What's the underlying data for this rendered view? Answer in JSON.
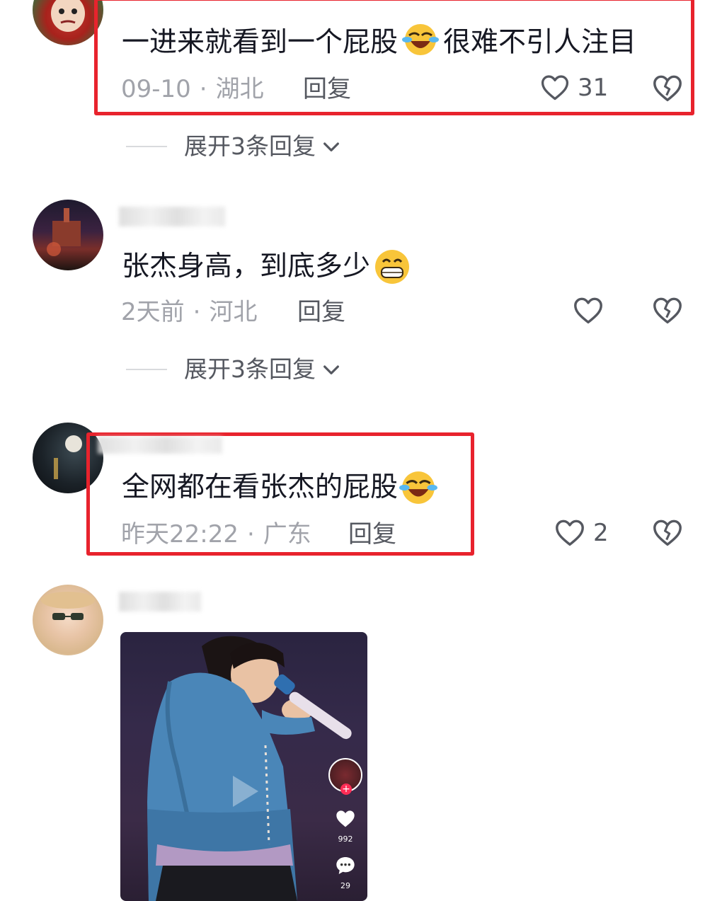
{
  "comments": [
    {
      "text": "一进来就看到一个屁股",
      "text2": "很难不引人注目",
      "date": "09-10",
      "location": "湖北",
      "reply_label": "回复",
      "likes": "31",
      "expand_label": "展开3条回复"
    },
    {
      "text": "张杰身高，到底多少",
      "date": "2天前",
      "location": "河北",
      "reply_label": "回复",
      "likes": "",
      "expand_label": "展开3条回复"
    },
    {
      "text": "全网都在看张杰的屁股",
      "date": "昨天22:22",
      "location": "广东",
      "reply_label": "回复",
      "likes": "2"
    },
    {
      "video": {
        "like_count": "992",
        "comment_count": "29"
      }
    }
  ],
  "colors": {
    "highlight": "#e8232d",
    "meta": "#a1a3aa",
    "text": "#161823",
    "jacket": "#4a86b8"
  },
  "icons": [
    "emoji-laughing-crying-icon",
    "emoji-grinning-icon",
    "heart-outline-icon",
    "broken-heart-icon",
    "chevron-down-icon",
    "play-icon",
    "comment-bubble-icon"
  ]
}
